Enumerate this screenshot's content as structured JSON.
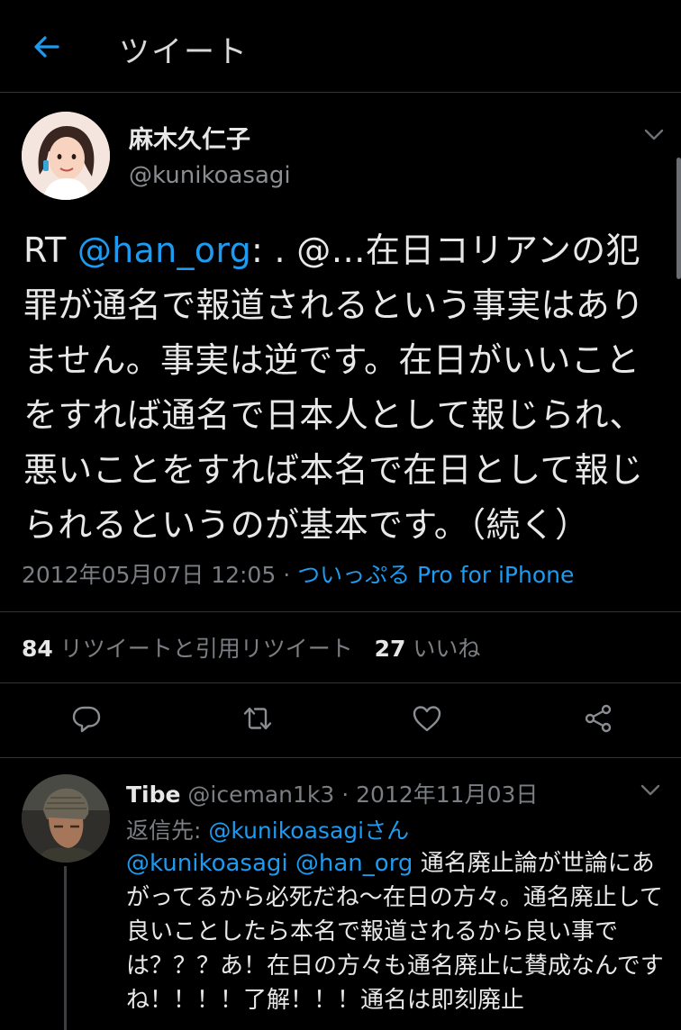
{
  "header": {
    "title": "ツイート"
  },
  "tweet": {
    "author_name": "麻木久仁子",
    "author_handle": "@kunikoasagi",
    "text_prefix": "RT ",
    "mention": "@han_org",
    "text_body": ": . @…在日コリアンの犯罪が通名で報道されるという事実はありません。事実は逆です。在日がいいことをすれば通名で日本人として報じられ、悪いことをすれば本名で在日として報じられるというのが基本です。（続く）",
    "timestamp": "2012年05月07日 12:05",
    "separator": " · ",
    "source": "ついっぷる Pro for iPhone",
    "retweet_count": "84",
    "retweet_label": "リツイートと引用リツイート",
    "like_count": "27",
    "like_label": "いいね"
  },
  "actions": [
    "reply-icon",
    "retweet-icon",
    "like-icon",
    "share-icon"
  ],
  "reply": {
    "name": "Tibe",
    "handle_date": " @iceman1k3 · 2012年11月03日",
    "reply_to_label": "返信先: ",
    "reply_to_user": "@kunikoasagiさん",
    "mention1": "@kunikoasagi",
    "mention2": "@han_org",
    "text": " 通名廃止論が世論にあがってるから必死だね〜在日の方々。通名廃止して良いことしたら本名で報道されるから良い事では？？？あ！在日の方々も通名廃止に賛成なんですね！！！！了解！！！通名は即刻廃止"
  },
  "colors": {
    "background": "#000000",
    "accent": "#1d9bf0",
    "secondary_text": "#7b7f83"
  }
}
